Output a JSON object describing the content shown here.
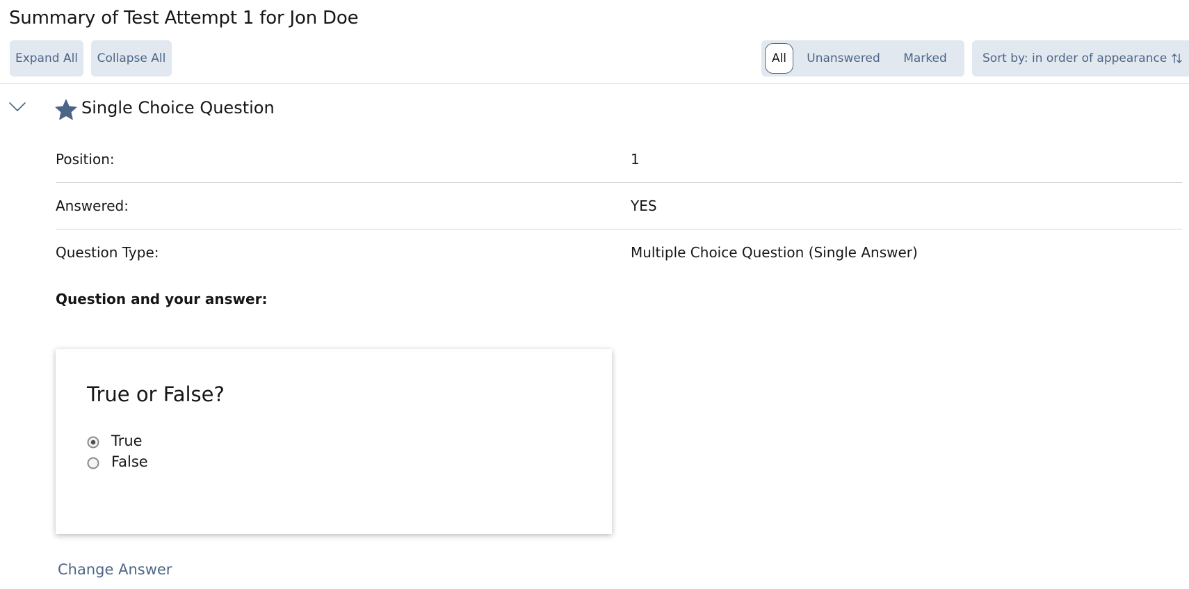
{
  "page": {
    "title": "Summary of Test Attempt 1 for Jon Doe"
  },
  "toolbar": {
    "expand_label": "Expand All",
    "collapse_label": "Collapse All",
    "filters": [
      {
        "label": "All",
        "selected": true
      },
      {
        "label": "Unanswered",
        "selected": false
      },
      {
        "label": "Marked",
        "selected": false
      }
    ],
    "sort_label": "Sort by: in order of appearance"
  },
  "question": {
    "heading": "Single Choice Question",
    "marked_icon": "star-icon",
    "details": [
      {
        "label": "Position:",
        "value": "1"
      },
      {
        "label": "Answered:",
        "value": "YES"
      },
      {
        "label": "Question Type:",
        "value": "Multiple Choice Question (Single Answer)"
      }
    ],
    "answer_heading": "Question and your answer:",
    "card": {
      "question_text": "True or False?",
      "options": [
        {
          "label": "True",
          "checked": true
        },
        {
          "label": "False",
          "checked": false
        }
      ]
    },
    "change_answer_label": "Change Answer"
  },
  "colors": {
    "accent": "#4c6586",
    "button_bg": "#e2e8ef",
    "divider": "#d3d7dc",
    "text": "#161616"
  }
}
